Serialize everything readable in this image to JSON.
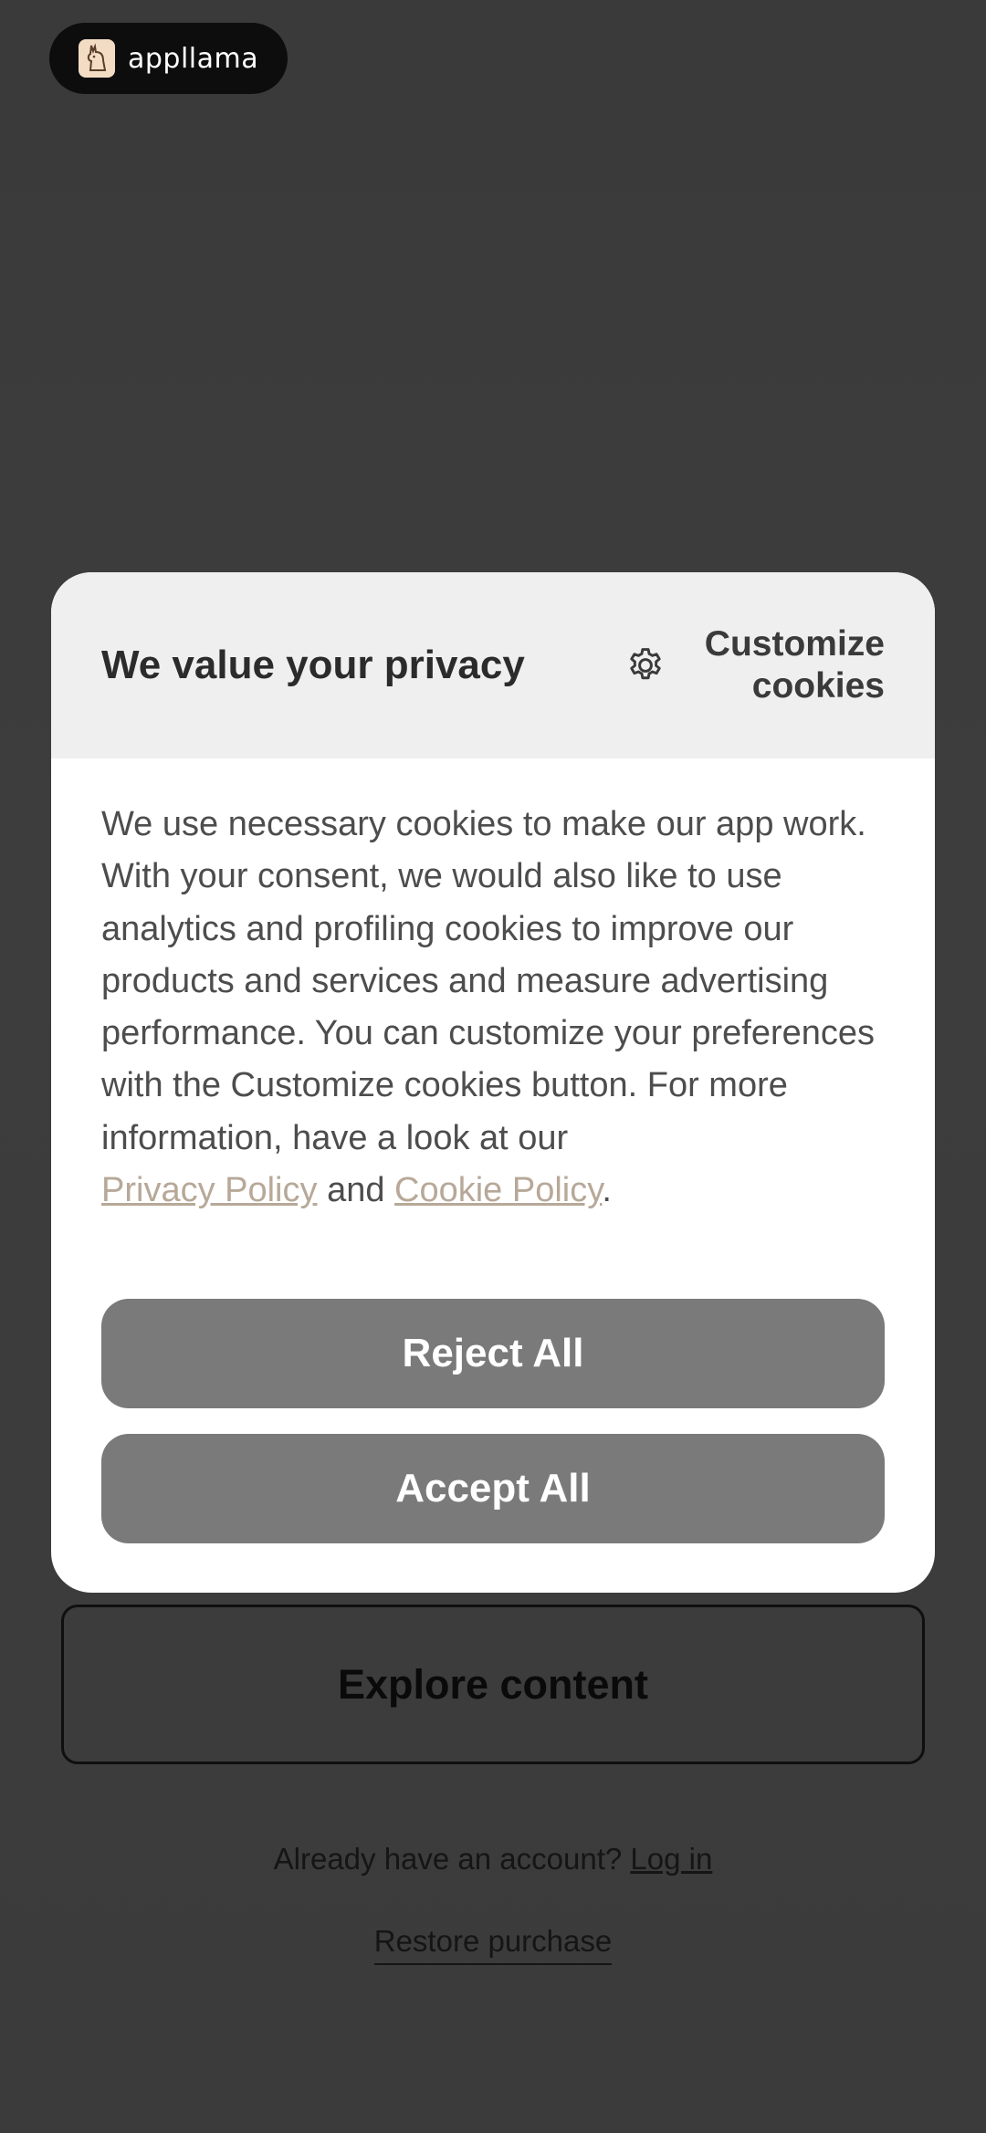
{
  "logo": {
    "text": "appllama",
    "icon": "llama-icon"
  },
  "background": {
    "explore_button": "Explore content",
    "account_prompt": "Already have an account?",
    "login_link": "Log in",
    "restore_link": "Restore purchase"
  },
  "consent": {
    "title": "We value your privacy",
    "customize_label_line1": "Customize",
    "customize_label_line2": "cookies",
    "customize_icon": "gear-icon",
    "body": "We use necessary cookies to make our app work. With your consent, we would also like to use analytics and profiling cookies to improve our products and services and measure advertising performance. You can customize your preferences with the Customize cookies button. For more information, have a look at our",
    "privacy_link": "Privacy Policy",
    "and_text": "and",
    "cookie_link": "Cookie Policy",
    "end_punct": ".",
    "reject_label": "Reject All",
    "accept_label": "Accept All"
  },
  "colors": {
    "overlay_bg": "#3b3b3b",
    "header_bg": "#efefef",
    "button_bg": "#7a7a7a",
    "link": "#b7a898"
  }
}
